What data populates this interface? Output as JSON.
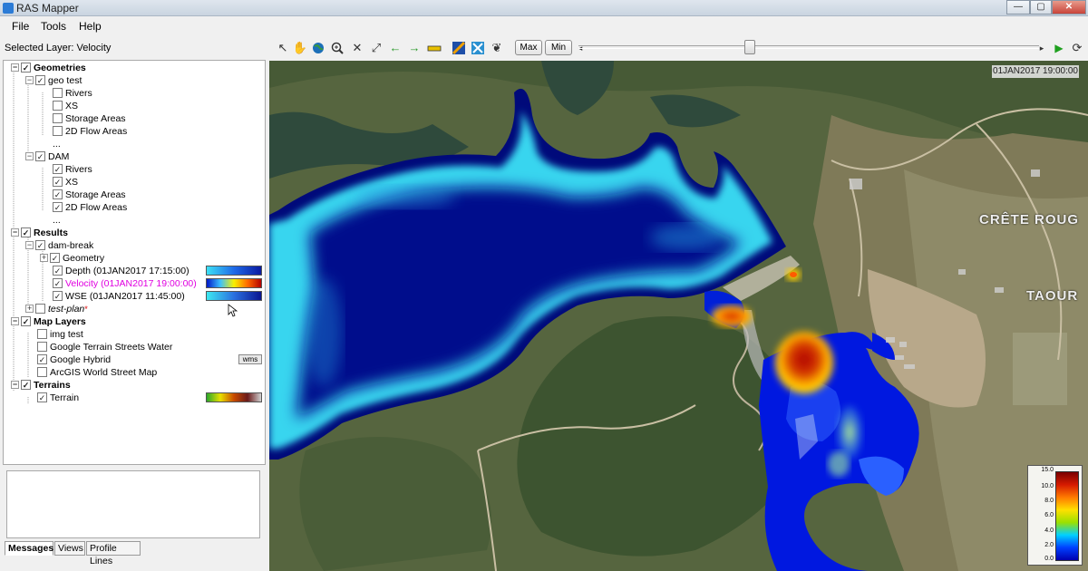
{
  "window": {
    "title": "RAS Mapper",
    "min": "—",
    "max": "▢",
    "close": "✕"
  },
  "menu": {
    "file": "File",
    "tools": "Tools",
    "help": "Help"
  },
  "selected_layer": "Selected Layer: Velocity",
  "toolbar": {
    "max_label": "Max",
    "min_label": "Min",
    "play": "▶",
    "refresh": "⟳",
    "arrow_left": "◂",
    "arrow_right": "▸"
  },
  "tree": {
    "geometries": "Geometries",
    "geo_test": "geo test",
    "geo_test_rivers": "Rivers",
    "geo_test_xs": "XS",
    "geo_test_storage": "Storage Areas",
    "geo_test_2d": "2D Flow Areas",
    "ellipsis": "...",
    "dam": "DAM",
    "dam_rivers": "Rivers",
    "dam_xs": "XS",
    "dam_storage": "Storage Areas",
    "dam_2d": "2D Flow Areas",
    "results": "Results",
    "dam_break": "dam-break",
    "geometry": "Geometry",
    "depth": "Depth (01JAN2017 17:15:00)",
    "velocity": "Velocity (01JAN2017 19:00:00)",
    "wse": "WSE (01JAN2017 11:45:00)",
    "test_plan": "test-plan",
    "test_plan_mark": "*",
    "map_layers": "Map Layers",
    "img_test": "img test",
    "google_terrain": "Google Terrain Streets Water",
    "google_hybrid": "Google Hybrid",
    "wms": "wms",
    "arcgis": "ArcGIS World Street Map",
    "terrains": "Terrains",
    "terrain": "Terrain"
  },
  "tabs": {
    "messages": "Messages",
    "views": "Views",
    "profile_lines": "Profile Lines"
  },
  "map": {
    "timestamp": "01JAN2017 19:00:00",
    "place_1": "CRÊTE ROUG",
    "place_2": "TAOUR",
    "legend_ticks": [
      "15.0",
      "10.0",
      "8.0",
      "6.0",
      "4.0",
      "2.0",
      "0.0"
    ]
  },
  "colors": {
    "water_deep": "#000a8c",
    "water_shallow": "#33d6f0",
    "velocity_high": "#cc1a00",
    "selection": "#e000e0"
  }
}
